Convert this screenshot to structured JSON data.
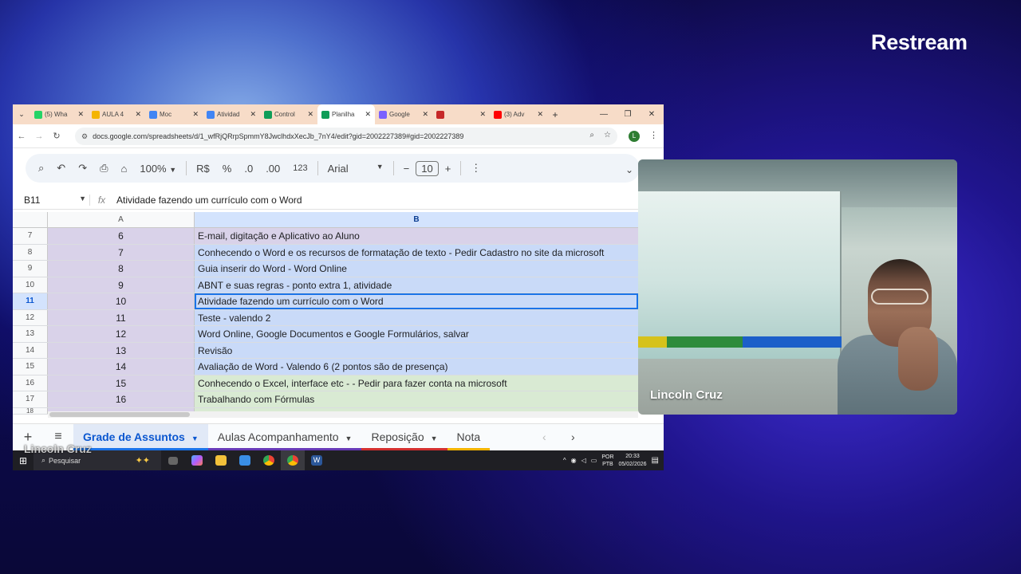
{
  "brand": {
    "logo": "Restream"
  },
  "browser": {
    "tabs": [
      {
        "title": "(5) Wha",
        "color": "#25d366"
      },
      {
        "title": "AULA 4",
        "color": "#f4b400"
      },
      {
        "title": "Moc",
        "color": "#4285f4"
      },
      {
        "title": "Atividad",
        "color": "#4285f4"
      },
      {
        "title": "Control",
        "color": "#0f9d58"
      },
      {
        "title": "Planilha",
        "color": "#0f9d58",
        "active": true
      },
      {
        "title": "Google",
        "color": "#7b61ff"
      },
      {
        "title": "",
        "color": "#c62828"
      },
      {
        "title": "(3) Adv",
        "color": "#ff0000"
      }
    ],
    "url": "docs.google.com/spreadsheets/d/1_wfRjQRrpSpmmY8JwclhdxXecJb_7nY4/edit?gid=2002227389#gid=2002227389",
    "profile_initial": "L"
  },
  "toolbar": {
    "zoom": "100%",
    "currency": "R$",
    "percent": "%",
    "dec_less": ".0",
    "dec_more": ".00",
    "format_123": "123",
    "font": "Arial",
    "font_size": "10"
  },
  "formula_bar": {
    "cell_ref": "B11",
    "content": "Atividade fazendo um currículo com o Word"
  },
  "sheet": {
    "col_a": "A",
    "col_b": "B",
    "rows": [
      {
        "rn": "7",
        "a": "6",
        "b": "E-mail, digitação e Aplicativo ao Aluno",
        "bg": "#d9d2e9",
        "abg": "#d9d2e9"
      },
      {
        "rn": "8",
        "a": "7",
        "b": "Conhecendo o Word e os recursos de formatação de texto - Pedir Cadastro no site da microsoft",
        "bg": "#c9daf8",
        "abg": "#d9d2e9"
      },
      {
        "rn": "9",
        "a": "8",
        "b": "Guia inserir do Word - Word Online",
        "bg": "#c9daf8",
        "abg": "#d9d2e9"
      },
      {
        "rn": "10",
        "a": "9",
        "b": "ABNT e suas regras - ponto extra 1, atividade",
        "bg": "#c9daf8",
        "abg": "#d9d2e9"
      },
      {
        "rn": "11",
        "a": "10",
        "b": "Atividade fazendo um currículo com o Word",
        "bg": "#c9daf8",
        "abg": "#d9d2e9",
        "selected": true
      },
      {
        "rn": "12",
        "a": "11",
        "b": "Teste - valendo 2",
        "bg": "#c9daf8",
        "abg": "#d9d2e9"
      },
      {
        "rn": "13",
        "a": "12",
        "b": "Word Online, Google Documentos e Google Formulários, salvar",
        "bg": "#c9daf8",
        "abg": "#d9d2e9"
      },
      {
        "rn": "14",
        "a": "13",
        "b": "Revisão",
        "bg": "#c9daf8",
        "abg": "#d9d2e9"
      },
      {
        "rn": "15",
        "a": "14",
        "b": "Avaliação de Word - Valendo 6 (2 pontos são de presença)",
        "bg": "#c9daf8",
        "abg": "#d9d2e9"
      },
      {
        "rn": "16",
        "a": "15",
        "b": "Conhecendo o Excel, interface etc - - Pedir para fazer conta na microsoft",
        "bg": "#d9ead3",
        "abg": "#d9d2e9"
      },
      {
        "rn": "17",
        "a": "16",
        "b": "Trabalhando com Fórmulas",
        "bg": "#d9ead3",
        "abg": "#d9d2e9"
      }
    ]
  },
  "sheet_tabs": [
    {
      "label": "Grade de Assuntos",
      "active": true,
      "color": "#1a73e8"
    },
    {
      "label": "Aulas Acompanhamento",
      "color": "#673ab7"
    },
    {
      "label": "Reposição",
      "color": "#d32f2f"
    },
    {
      "label": "Nota",
      "color": "#f4b400"
    }
  ],
  "taskbar": {
    "search": "Pesquisar",
    "lang_1": "POR",
    "lang_2": "PTB",
    "time": "20:33",
    "date": "05/02/2026"
  },
  "overlay_name": "Lincoln Cruz",
  "webcam": {
    "name": "Lincoln Cruz"
  }
}
